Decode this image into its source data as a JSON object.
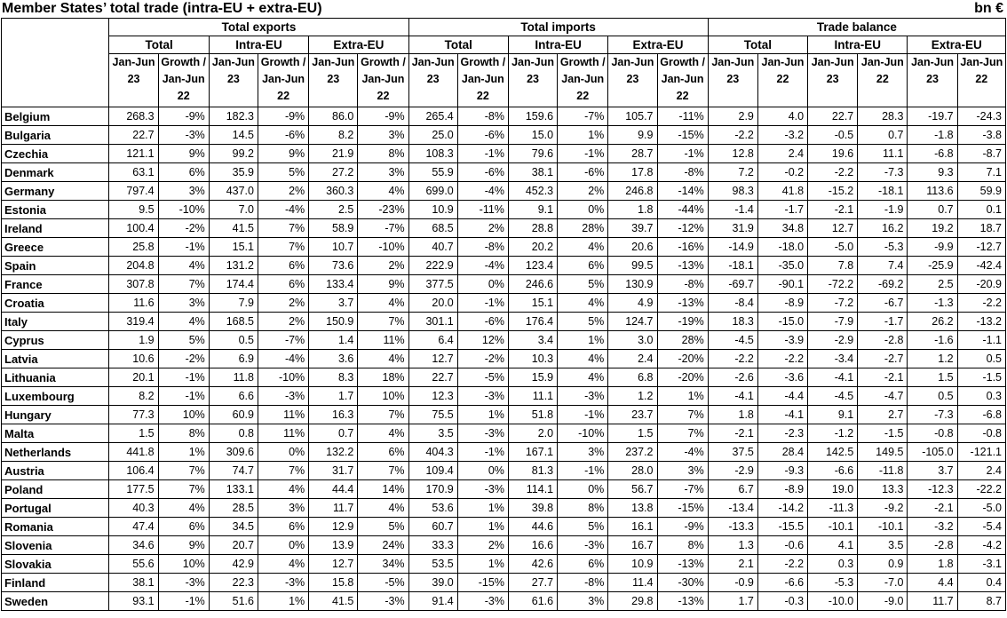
{
  "header": {
    "title": "Member States’ total trade (intra-EU + extra-EU)",
    "unit": "bn €"
  },
  "groups": [
    "Total exports",
    "Total imports",
    "Trade balance"
  ],
  "subgroups": [
    "Total",
    "Intra-EU",
    "Extra-EU",
    "Total",
    "Intra-EU",
    "Extra-EU",
    "Total",
    "Intra-EU",
    "Extra-EU"
  ],
  "columns": [
    "Jan-Jun 23",
    "Growth / Jan-Jun 22",
    "Jan-Jun 23",
    "Growth / Jan-Jun 22",
    "Jan-Jun 23",
    "Growth / Jan-Jun 22",
    "Jan-Jun 23",
    "Growth / Jan-Jun 22",
    "Jan-Jun 23",
    "Growth / Jan-Jun 22",
    "Jan-Jun 23",
    "Growth / Jan-Jun 22",
    "Jan-Jun 23",
    "Jan-Jun 22",
    "Jan-Jun 23",
    "Jan-Jun 22",
    "Jan-Jun 23",
    "Jan-Jun 22"
  ],
  "rows": [
    [
      "Belgium",
      "268.3",
      "-9%",
      "182.3",
      "-9%",
      "86.0",
      "-9%",
      "265.4",
      "-8%",
      "159.6",
      "-7%",
      "105.7",
      "-11%",
      "2.9",
      "4.0",
      "22.7",
      "28.3",
      "-19.7",
      "-24.3"
    ],
    [
      "Bulgaria",
      "22.7",
      "-3%",
      "14.5",
      "-6%",
      "8.2",
      "3%",
      "25.0",
      "-6%",
      "15.0",
      "1%",
      "9.9",
      "-15%",
      "-2.2",
      "-3.2",
      "-0.5",
      "0.7",
      "-1.8",
      "-3.8"
    ],
    [
      "Czechia",
      "121.1",
      "9%",
      "99.2",
      "9%",
      "21.9",
      "8%",
      "108.3",
      "-1%",
      "79.6",
      "-1%",
      "28.7",
      "-1%",
      "12.8",
      "2.4",
      "19.6",
      "11.1",
      "-6.8",
      "-8.7"
    ],
    [
      "Denmark",
      "63.1",
      "6%",
      "35.9",
      "5%",
      "27.2",
      "3%",
      "55.9",
      "-6%",
      "38.1",
      "-6%",
      "17.8",
      "-8%",
      "7.2",
      "-0.2",
      "-2.2",
      "-7.3",
      "9.3",
      "7.1"
    ],
    [
      "Germany",
      "797.4",
      "3%",
      "437.0",
      "2%",
      "360.3",
      "4%",
      "699.0",
      "-4%",
      "452.3",
      "2%",
      "246.8",
      "-14%",
      "98.3",
      "41.8",
      "-15.2",
      "-18.1",
      "113.6",
      "59.9"
    ],
    [
      "Estonia",
      "9.5",
      "-10%",
      "7.0",
      "-4%",
      "2.5",
      "-23%",
      "10.9",
      "-11%",
      "9.1",
      "0%",
      "1.8",
      "-44%",
      "-1.4",
      "-1.7",
      "-2.1",
      "-1.9",
      "0.7",
      "0.1"
    ],
    [
      "Ireland",
      "100.4",
      "-2%",
      "41.5",
      "7%",
      "58.9",
      "-7%",
      "68.5",
      "2%",
      "28.8",
      "28%",
      "39.7",
      "-12%",
      "31.9",
      "34.8",
      "12.7",
      "16.2",
      "19.2",
      "18.7"
    ],
    [
      "Greece",
      "25.8",
      "-1%",
      "15.1",
      "7%",
      "10.7",
      "-10%",
      "40.7",
      "-8%",
      "20.2",
      "4%",
      "20.6",
      "-16%",
      "-14.9",
      "-18.0",
      "-5.0",
      "-5.3",
      "-9.9",
      "-12.7"
    ],
    [
      "Spain",
      "204.8",
      "4%",
      "131.2",
      "6%",
      "73.6",
      "2%",
      "222.9",
      "-4%",
      "123.4",
      "6%",
      "99.5",
      "-13%",
      "-18.1",
      "-35.0",
      "7.8",
      "7.4",
      "-25.9",
      "-42.4"
    ],
    [
      "France",
      "307.8",
      "7%",
      "174.4",
      "6%",
      "133.4",
      "9%",
      "377.5",
      "0%",
      "246.6",
      "5%",
      "130.9",
      "-8%",
      "-69.7",
      "-90.1",
      "-72.2",
      "-69.2",
      "2.5",
      "-20.9"
    ],
    [
      "Croatia",
      "11.6",
      "3%",
      "7.9",
      "2%",
      "3.7",
      "4%",
      "20.0",
      "-1%",
      "15.1",
      "4%",
      "4.9",
      "-13%",
      "-8.4",
      "-8.9",
      "-7.2",
      "-6.7",
      "-1.3",
      "-2.2"
    ],
    [
      "Italy",
      "319.4",
      "4%",
      "168.5",
      "2%",
      "150.9",
      "7%",
      "301.1",
      "-6%",
      "176.4",
      "5%",
      "124.7",
      "-19%",
      "18.3",
      "-15.0",
      "-7.9",
      "-1.7",
      "26.2",
      "-13.2"
    ],
    [
      "Cyprus",
      "1.9",
      "5%",
      "0.5",
      "-7%",
      "1.4",
      "11%",
      "6.4",
      "12%",
      "3.4",
      "1%",
      "3.0",
      "28%",
      "-4.5",
      "-3.9",
      "-2.9",
      "-2.8",
      "-1.6",
      "-1.1"
    ],
    [
      "Latvia",
      "10.6",
      "-2%",
      "6.9",
      "-4%",
      "3.6",
      "4%",
      "12.7",
      "-2%",
      "10.3",
      "4%",
      "2.4",
      "-20%",
      "-2.2",
      "-2.2",
      "-3.4",
      "-2.7",
      "1.2",
      "0.5"
    ],
    [
      "Lithuania",
      "20.1",
      "-1%",
      "11.8",
      "-10%",
      "8.3",
      "18%",
      "22.7",
      "-5%",
      "15.9",
      "4%",
      "6.8",
      "-20%",
      "-2.6",
      "-3.6",
      "-4.1",
      "-2.1",
      "1.5",
      "-1.5"
    ],
    [
      "Luxembourg",
      "8.2",
      "-1%",
      "6.6",
      "-3%",
      "1.7",
      "10%",
      "12.3",
      "-3%",
      "11.1",
      "-3%",
      "1.2",
      "1%",
      "-4.1",
      "-4.4",
      "-4.5",
      "-4.7",
      "0.5",
      "0.3"
    ],
    [
      "Hungary",
      "77.3",
      "10%",
      "60.9",
      "11%",
      "16.3",
      "7%",
      "75.5",
      "1%",
      "51.8",
      "-1%",
      "23.7",
      "7%",
      "1.8",
      "-4.1",
      "9.1",
      "2.7",
      "-7.3",
      "-6.8"
    ],
    [
      "Malta",
      "1.5",
      "8%",
      "0.8",
      "11%",
      "0.7",
      "4%",
      "3.5",
      "-3%",
      "2.0",
      "-10%",
      "1.5",
      "7%",
      "-2.1",
      "-2.3",
      "-1.2",
      "-1.5",
      "-0.8",
      "-0.8"
    ],
    [
      "Netherlands",
      "441.8",
      "1%",
      "309.6",
      "0%",
      "132.2",
      "6%",
      "404.3",
      "-1%",
      "167.1",
      "3%",
      "237.2",
      "-4%",
      "37.5",
      "28.4",
      "142.5",
      "149.5",
      "-105.0",
      "-121.1"
    ],
    [
      "Austria",
      "106.4",
      "7%",
      "74.7",
      "7%",
      "31.7",
      "7%",
      "109.4",
      "0%",
      "81.3",
      "-1%",
      "28.0",
      "3%",
      "-2.9",
      "-9.3",
      "-6.6",
      "-11.8",
      "3.7",
      "2.4"
    ],
    [
      "Poland",
      "177.5",
      "7%",
      "133.1",
      "4%",
      "44.4",
      "14%",
      "170.9",
      "-3%",
      "114.1",
      "0%",
      "56.7",
      "-7%",
      "6.7",
      "-8.9",
      "19.0",
      "13.3",
      "-12.3",
      "-22.2"
    ],
    [
      "Portugal",
      "40.3",
      "4%",
      "28.5",
      "3%",
      "11.7",
      "4%",
      "53.6",
      "1%",
      "39.8",
      "8%",
      "13.8",
      "-15%",
      "-13.4",
      "-14.2",
      "-11.3",
      "-9.2",
      "-2.1",
      "-5.0"
    ],
    [
      "Romania",
      "47.4",
      "6%",
      "34.5",
      "6%",
      "12.9",
      "5%",
      "60.7",
      "1%",
      "44.6",
      "5%",
      "16.1",
      "-9%",
      "-13.3",
      "-15.5",
      "-10.1",
      "-10.1",
      "-3.2",
      "-5.4"
    ],
    [
      "Slovenia",
      "34.6",
      "9%",
      "20.7",
      "0%",
      "13.9",
      "24%",
      "33.3",
      "2%",
      "16.6",
      "-3%",
      "16.7",
      "8%",
      "1.3",
      "-0.6",
      "4.1",
      "3.5",
      "-2.8",
      "-4.2"
    ],
    [
      "Slovakia",
      "55.6",
      "10%",
      "42.9",
      "4%",
      "12.7",
      "34%",
      "53.5",
      "1%",
      "42.6",
      "6%",
      "10.9",
      "-13%",
      "2.1",
      "-2.2",
      "0.3",
      "0.9",
      "1.8",
      "-3.1"
    ],
    [
      "Finland",
      "38.1",
      "-3%",
      "22.3",
      "-3%",
      "15.8",
      "-5%",
      "39.0",
      "-15%",
      "27.7",
      "-8%",
      "11.4",
      "-30%",
      "-0.9",
      "-6.6",
      "-5.3",
      "-7.0",
      "4.4",
      "0.4"
    ],
    [
      "Sweden",
      "93.1",
      "-1%",
      "51.6",
      "1%",
      "41.5",
      "-3%",
      "91.4",
      "-3%",
      "61.6",
      "3%",
      "29.8",
      "-13%",
      "1.7",
      "-0.3",
      "-10.0",
      "-9.0",
      "11.7",
      "8.7"
    ]
  ]
}
